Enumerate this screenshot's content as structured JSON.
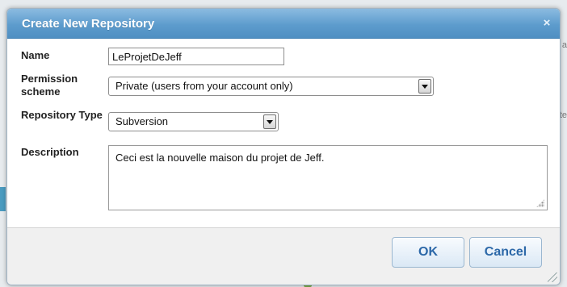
{
  "dialog": {
    "title": "Create New Repository",
    "close_icon": "×"
  },
  "form": {
    "name": {
      "label": "Name",
      "value": "LeProjetDeJeff"
    },
    "permission": {
      "label_line1": "Permission",
      "label_line2": "scheme",
      "selected": "Private (users from your account only)"
    },
    "repo_type": {
      "label": "Repository Type",
      "selected": "Subversion"
    },
    "description": {
      "label": "Description",
      "value": "Ceci est la nouvelle maison du projet de Jeff."
    }
  },
  "buttons": {
    "ok_label": "OK",
    "cancel_label": "Cancel"
  },
  "background": {
    "right_text_1": "a",
    "right_text_2": "ate"
  },
  "colors": {
    "title_bar": "#5d9ccd",
    "button_text": "#2c68a8"
  }
}
